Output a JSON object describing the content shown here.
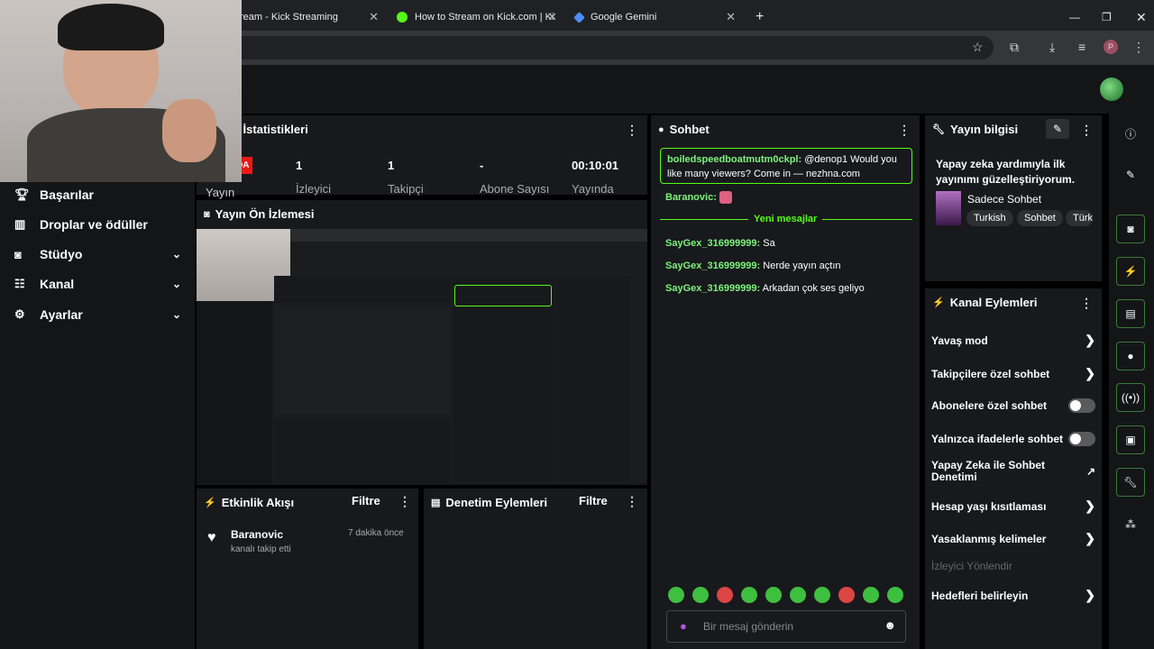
{
  "browser": {
    "tabs": [
      {
        "label": "ream - Kick Streaming"
      },
      {
        "label": "How to Stream on Kick.com | Ki"
      },
      {
        "label": "Google Gemini"
      }
    ],
    "url": "n"
  },
  "sidebar": {
    "items": [
      {
        "label": "Başarılar"
      },
      {
        "label": "Droplar ve ödüller"
      },
      {
        "label": "Stüdyo"
      },
      {
        "label": "Kanal"
      },
      {
        "label": "Ayarlar"
      }
    ]
  },
  "stats": {
    "title": "n İstatistikleri",
    "live_badge": "DA",
    "viewers_value": "1",
    "viewers_label": "İzleyici",
    "followers_value": "1",
    "followers_label": "Takipçi",
    "subs_value": "-",
    "subs_label": "Abone Sayısı",
    "uptime_value": "00:10:01",
    "uptime_label": "Yayında",
    "stream_label": "Yayın"
  },
  "preview": {
    "title": "Yayın Ön İzlemesi"
  },
  "activity": {
    "title": "Etkinlik Akışı",
    "filter": "Filtre",
    "event_user": "Baranovic",
    "event_text": "kanalı takip etti",
    "event_time": "7 dakika önce"
  },
  "moderation": {
    "title": "Denetim Eylemleri",
    "filter": "Filtre"
  },
  "chat": {
    "title": "Sohbet",
    "pinned_user": "boiledspeedboatmutm0ckpl:",
    "pinned_text": "@denop1 Would you like many viewers? Come in — nezhna.com",
    "reply_user": "Baranovic:",
    "new_messages": "Yeni mesajlar",
    "messages": [
      {
        "user": "SayGex_316999999:",
        "text": "Sa"
      },
      {
        "user": "SayGex_316999999:",
        "text": "Nerde yayın açtın"
      },
      {
        "user": "SayGex_316999999:",
        "text": "Arkadan çok ses geliyo"
      }
    ],
    "placeholder": "Bir mesaj gönderin"
  },
  "stream_info": {
    "title": "Yayın bilgisi",
    "stream_title": "Yapay zeka yardımıyla ilk yayınımı güzelleştiriyorum.",
    "category": "Sadece Sohbet",
    "tags": [
      "Turkish",
      "Sohbet",
      "Türk"
    ]
  },
  "channel_actions": {
    "title": "Kanal Eylemleri",
    "items": [
      {
        "label": "Yavaş mod"
      },
      {
        "label": "Takipçilere özel sohbet"
      },
      {
        "label": "Abonelere özel sohbet"
      },
      {
        "label": "Yalnızca ifadelerle sohbet"
      },
      {
        "label": "Yapay Zeka ile Sohbet Denetimi"
      },
      {
        "label": "Hesap yaşı kısıtlaması"
      },
      {
        "label": "Yasaklanmış kelimeler"
      },
      {
        "label": "İzleyici Yönlendir"
      },
      {
        "label": "Hedefleri belirleyin"
      }
    ]
  },
  "colors": {
    "accent": "#53fc18",
    "badge": "#e91916"
  }
}
